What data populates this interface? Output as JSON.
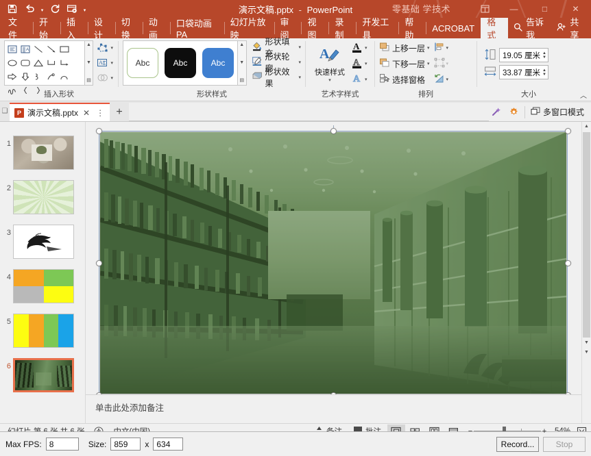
{
  "titlebar": {
    "quick_access": [
      {
        "name": "save-icon",
        "label": "保存"
      },
      {
        "name": "undo-icon",
        "label": "撤消"
      },
      {
        "name": "redo-icon",
        "label": "恢复"
      },
      {
        "name": "start-presentation-icon",
        "label": "从头开始"
      },
      {
        "name": "customize-qat-icon",
        "label": "自定义快速访问工具栏"
      }
    ],
    "document_title": "演示文稿.pptx",
    "separator": "-",
    "app_name": "PowerPoint",
    "watermark": "零基础 学技术",
    "ribbon_display_icon": "ribbon-display-options-icon",
    "minimize": "—",
    "maximize": "□",
    "close": "✕"
  },
  "ribbon_tabs": [
    {
      "label": "文件",
      "active": false
    },
    {
      "label": "开始",
      "active": false
    },
    {
      "label": "插入",
      "active": false
    },
    {
      "label": "设计",
      "active": false
    },
    {
      "label": "切换",
      "active": false
    },
    {
      "label": "动画",
      "active": false
    },
    {
      "label": "口袋动画 PA",
      "active": false
    },
    {
      "label": "幻灯片放映",
      "active": false
    },
    {
      "label": "审阅",
      "active": false
    },
    {
      "label": "视图",
      "active": false
    },
    {
      "label": "录制",
      "active": false
    },
    {
      "label": "开发工具",
      "active": false
    },
    {
      "label": "帮助",
      "active": false
    },
    {
      "label": "ACROBAT",
      "active": false
    },
    {
      "label": "格式",
      "active": true
    }
  ],
  "tellme": {
    "icon": "search-icon",
    "label": "告诉我"
  },
  "share": {
    "icon": "share-person-icon",
    "label": "共享"
  },
  "ribbon": {
    "groups": [
      {
        "name": "insert-shapes",
        "label": "插入形状",
        "gallery_rows": [
          [
            "text-box-shape",
            "vertical-text-shape",
            "line-shape",
            "arrow-shape",
            "rectangle-shape",
            "oval-shape"
          ],
          [
            "round-rect-shape",
            "triangle-shape",
            "elbow-connector-shape",
            "elbow-arrow-shape",
            "right-arrow-shape",
            "down-arrow-shape"
          ],
          [
            "curve-shape",
            "freeform-shape",
            "arc-shape",
            "double-arc-shape",
            "left-brace-shape",
            "right-brace-shape"
          ]
        ],
        "side_buttons": [
          "edit-shape-button",
          "text-box-button",
          "merge-shapes-button"
        ]
      },
      {
        "name": "shape-styles",
        "label": "形状样式",
        "presets": [
          {
            "name": "style-preset-light",
            "text": "Abc"
          },
          {
            "name": "style-preset-dark",
            "text": "Abc"
          },
          {
            "name": "style-preset-accent",
            "text": "Abc"
          }
        ],
        "commands": [
          {
            "name": "shape-fill",
            "label": "形状填充"
          },
          {
            "name": "shape-outline",
            "label": "形状轮廓"
          },
          {
            "name": "shape-effects",
            "label": "形状效果"
          }
        ]
      },
      {
        "name": "wordart-styles",
        "label": "艺术字样式",
        "quick_styles_label": "快速样式",
        "commands": [
          {
            "name": "text-fill",
            "label": "A"
          },
          {
            "name": "text-outline",
            "label": "A"
          },
          {
            "name": "text-effects",
            "label": "A"
          }
        ]
      },
      {
        "name": "arrange",
        "label": "排列",
        "commands": [
          {
            "name": "bring-forward",
            "label": "上移一层"
          },
          {
            "name": "send-backward",
            "label": "下移一层"
          },
          {
            "name": "selection-pane",
            "label": "选择窗格"
          }
        ],
        "icon_commands": [
          {
            "name": "align-objects",
            "label": "对齐"
          },
          {
            "name": "group-objects",
            "label": "组合"
          },
          {
            "name": "rotate-objects",
            "label": "旋转"
          }
        ]
      },
      {
        "name": "size",
        "label": "大小",
        "height": {
          "name": "shape-height",
          "value": "19.05 厘米"
        },
        "width": {
          "name": "shape-width",
          "value": "33.87 厘米"
        }
      }
    ],
    "collapse_icon": "collapse-ribbon-icon"
  },
  "doc_tabs": {
    "tabs": [
      {
        "name": "doc-tab-presentation",
        "label": "演示文稿.pptx",
        "icon": "powerpoint-icon",
        "close": "✕",
        "more": "⋮",
        "active": true
      }
    ],
    "new_tab": "+",
    "right_icons": [
      {
        "name": "magic-wand-icon"
      },
      {
        "name": "settings-gear-icon"
      }
    ],
    "multi_window": {
      "name": "multi-window-mode",
      "label": "多窗口模式",
      "icon": "window-icon"
    }
  },
  "thumbnails": [
    {
      "number": "1",
      "name": "slide-thumb-1",
      "selected": false,
      "kind": "photo-desk"
    },
    {
      "number": "2",
      "name": "slide-thumb-2",
      "selected": false,
      "kind": "green-rays"
    },
    {
      "number": "3",
      "name": "slide-thumb-3",
      "selected": false,
      "kind": "ink-horse"
    },
    {
      "number": "4",
      "name": "slide-thumb-4",
      "selected": false,
      "kind": "quad-color"
    },
    {
      "number": "5",
      "name": "slide-thumb-5",
      "selected": false,
      "kind": "stripes"
    },
    {
      "number": "6",
      "name": "slide-thumb-6",
      "selected": true,
      "kind": "library"
    }
  ],
  "slide": {
    "picture_name": "library-corridor-picture",
    "recolor": "green-tint",
    "selected": true,
    "handles": 8
  },
  "notes": {
    "placeholder": "单击此处添加备注"
  },
  "statusbar": {
    "slide_info": "幻灯片 第 6 张  共 6 张",
    "accessibility_icon": "accessibility-icon",
    "language": "中文(中国)",
    "notes_button": {
      "label": "备注",
      "icon": "notes-icon"
    },
    "comments_button": {
      "label": "批注",
      "icon": "comments-icon"
    },
    "views": [
      {
        "name": "view-normal",
        "active": true
      },
      {
        "name": "view-slide-sorter",
        "active": false
      },
      {
        "name": "view-reading",
        "active": false
      },
      {
        "name": "view-slideshow",
        "active": false
      }
    ],
    "zoom_minus": "−",
    "zoom_plus": "+",
    "zoom_level": "54%",
    "fit_to_window": "fit-slide-icon"
  },
  "recorder": {
    "max_fps_label": "Max FPS:",
    "max_fps_value": "8",
    "size_label": "Size:",
    "size_width": "859",
    "size_x": "x",
    "size_height": "634",
    "record_button": "Record...",
    "stop_button": "Stop"
  },
  "colors": {
    "ribbon_red": "#b7472a",
    "tab_active_bg": "#f0f0f0",
    "accent_orange": "#e8553a",
    "picture_green": "#4f7a43",
    "selection_blue": "#8ea9c7"
  }
}
